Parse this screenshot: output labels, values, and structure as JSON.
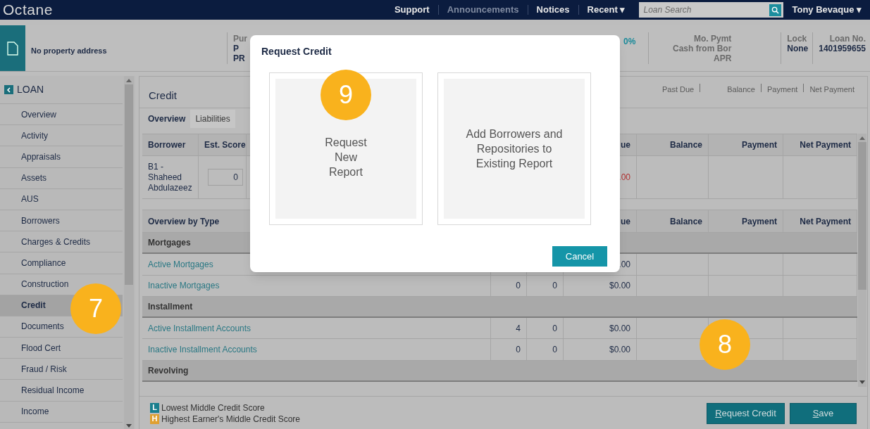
{
  "nav": {
    "logo": "Octane",
    "links": [
      {
        "label": "Support",
        "muted": false
      },
      {
        "label": "Announcements",
        "muted": true
      },
      {
        "label": "Notices",
        "muted": false
      },
      {
        "label": "Recent ▾",
        "muted": false
      }
    ],
    "search": {
      "placeholder": "Loan Search"
    },
    "user": "Tony Bevaque ▾"
  },
  "header": {
    "address": "No property address",
    "purpose": [
      "Pur",
      "P",
      "PR"
    ],
    "rate": "0%",
    "payment_labels": [
      "Mo. Pymt",
      "Cash from Bor",
      "APR"
    ],
    "lock": {
      "label": "Lock",
      "value": "None"
    },
    "loan_no": {
      "label": "Loan No.",
      "value": "1401959655"
    }
  },
  "sidebar": {
    "title": "LOAN",
    "items": [
      {
        "label": "Overview",
        "selected": false
      },
      {
        "label": "Activity",
        "selected": false
      },
      {
        "label": "Appraisals",
        "selected": false
      },
      {
        "label": "Assets",
        "selected": false
      },
      {
        "label": "AUS",
        "selected": false
      },
      {
        "label": "Borrowers",
        "selected": false
      },
      {
        "label": "Charges & Credits",
        "selected": false
      },
      {
        "label": "Compliance",
        "selected": false
      },
      {
        "label": "Construction",
        "selected": false
      },
      {
        "label": "Credit",
        "selected": true
      },
      {
        "label": "Documents",
        "selected": false
      },
      {
        "label": "Flood Cert",
        "selected": false
      },
      {
        "label": "Fraud / Risk",
        "selected": false
      },
      {
        "label": "Residual Income",
        "selected": false
      },
      {
        "label": "Income",
        "selected": false
      }
    ]
  },
  "main": {
    "title": "Credit",
    "summary_labels": [
      "Past Due",
      "Balance",
      "Payment",
      "Net Payment"
    ],
    "tabs": [
      {
        "label": "Overview",
        "selected": true
      },
      {
        "label": "Liabilities",
        "selected": false
      }
    ],
    "borrower_table": {
      "columns": [
        "Borrower",
        "Est. Score",
        "ue",
        "Balance",
        "Payment",
        "Net Payment"
      ],
      "rows": [
        {
          "borrower": "B1 - Shaheed Abdulazeez",
          "score": "0",
          "due": ".00"
        }
      ]
    },
    "overview_table": {
      "columns": [
        "Overview by Type",
        "ue",
        "Balance",
        "Payment",
        "Net Payment"
      ],
      "rows": [
        {
          "kind": "group",
          "label": "Mortgages"
        },
        {
          "kind": "link",
          "label": "Active Mortgages",
          "due": ".00"
        },
        {
          "kind": "link",
          "label": "Inactive Mortgages",
          "count_1": "0",
          "count_2": "0",
          "due": "$0.00"
        },
        {
          "kind": "group",
          "label": "Installment"
        },
        {
          "kind": "link",
          "label": "Active Installment Accounts",
          "count_1": "4",
          "count_2": "0",
          "due": "$0.00"
        },
        {
          "kind": "link",
          "label": "Inactive Installment Accounts",
          "count_1": "0",
          "count_2": "0",
          "due": "$0.00"
        },
        {
          "kind": "group",
          "label": "Revolving"
        }
      ]
    }
  },
  "footer": {
    "legend": [
      {
        "letter": "L",
        "label": "Lowest Middle Credit Score",
        "color": "#1a7f8e"
      },
      {
        "letter": "H",
        "label": "Highest Earner's Middle Credit Score",
        "color": "#e0a030"
      }
    ],
    "buttons": [
      "Request Credit",
      "Save"
    ]
  },
  "modal": {
    "title": "Request Credit",
    "options": [
      "Request New Report",
      "Add Borrowers and Repositories to Existing Report"
    ],
    "cancel": "Cancel"
  },
  "callouts": [
    {
      "number": "7"
    },
    {
      "number": "8"
    },
    {
      "number": "9"
    }
  ]
}
